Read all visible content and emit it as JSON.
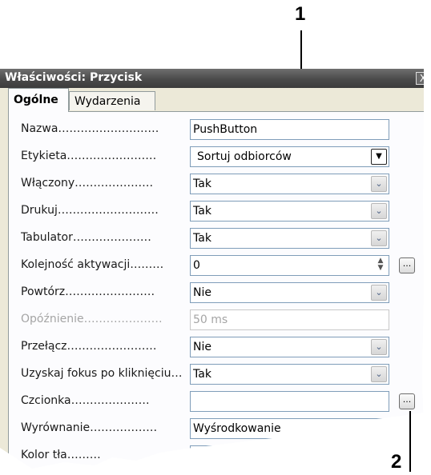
{
  "callouts": [
    "1",
    "2"
  ],
  "dialog": {
    "title": "Właściwości: Przycisk",
    "close_label": "X",
    "tabs": [
      {
        "label": "Ogólne",
        "active": true
      },
      {
        "label": "Wydarzenia",
        "active": false
      }
    ]
  },
  "properties": [
    {
      "label": "Nazwa………………………",
      "value": "PushButton",
      "control": "text"
    },
    {
      "label": "Etykieta……………………",
      "value": "Sortuj odbiorców",
      "control": "dropdown-plain"
    },
    {
      "label": "Włączony…………………",
      "value": "Tak",
      "control": "dropdown"
    },
    {
      "label": "Drukuj………………………",
      "value": "Tak",
      "control": "dropdown"
    },
    {
      "label": "Tabulator…………………",
      "value": "Tak",
      "control": "dropdown"
    },
    {
      "label": "Kolejność aktywacji………",
      "value": "0",
      "control": "spin",
      "button": "..."
    },
    {
      "label": "Powtórz……………………",
      "value": "Nie",
      "control": "dropdown"
    },
    {
      "label": "Opóźnienie…………………",
      "value": "50 ms",
      "control": "text",
      "disabled": true
    },
    {
      "label": "Przełącz……………………",
      "value": "Nie",
      "control": "dropdown"
    },
    {
      "label": "Uzyskaj fokus po kliknięciu…",
      "value": "Tak",
      "control": "dropdown"
    },
    {
      "label": "Czcionka…………………",
      "value": "",
      "control": "text",
      "button": "..."
    },
    {
      "label": "Wyrównanie………………",
      "value": "Wyśrodkowanie",
      "control": "dropdown"
    },
    {
      "label": "Kolor tła………",
      "value": "",
      "control": "text"
    }
  ],
  "icons": {
    "dropdown": "chevron-down-icon",
    "spin": "spin-arrows-icon",
    "close": "close-icon"
  }
}
